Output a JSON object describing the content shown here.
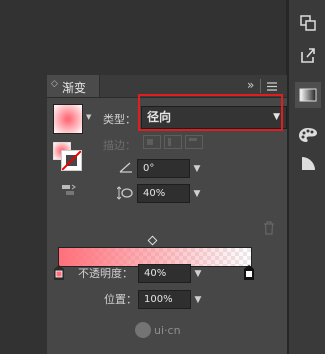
{
  "panel": {
    "title": "渐变",
    "tab_arrows": "»",
    "menu_icon": "panel-menu-icon",
    "type_label": "类型：",
    "type_value": "径向",
    "stroke_label": "描边：",
    "angle_value": "0°",
    "aspect_value": "40%",
    "opacity_label": "不透明度：",
    "opacity_value": "40%",
    "location_label": "位置：",
    "location_value": "100%",
    "gradient_start_color": "#ff6f7a",
    "gradient_end_color": "#ffffff",
    "stop_left_color": "#ff6f7a",
    "stop_right_color": "#ffffff"
  },
  "watermark": "ui·cn",
  "right_toolbar": {
    "icons": [
      "transform-icon",
      "export-icon",
      "gradient-icon",
      "palette-icon",
      "shape-icon"
    ]
  },
  "highlight_color": "#e11e1e"
}
